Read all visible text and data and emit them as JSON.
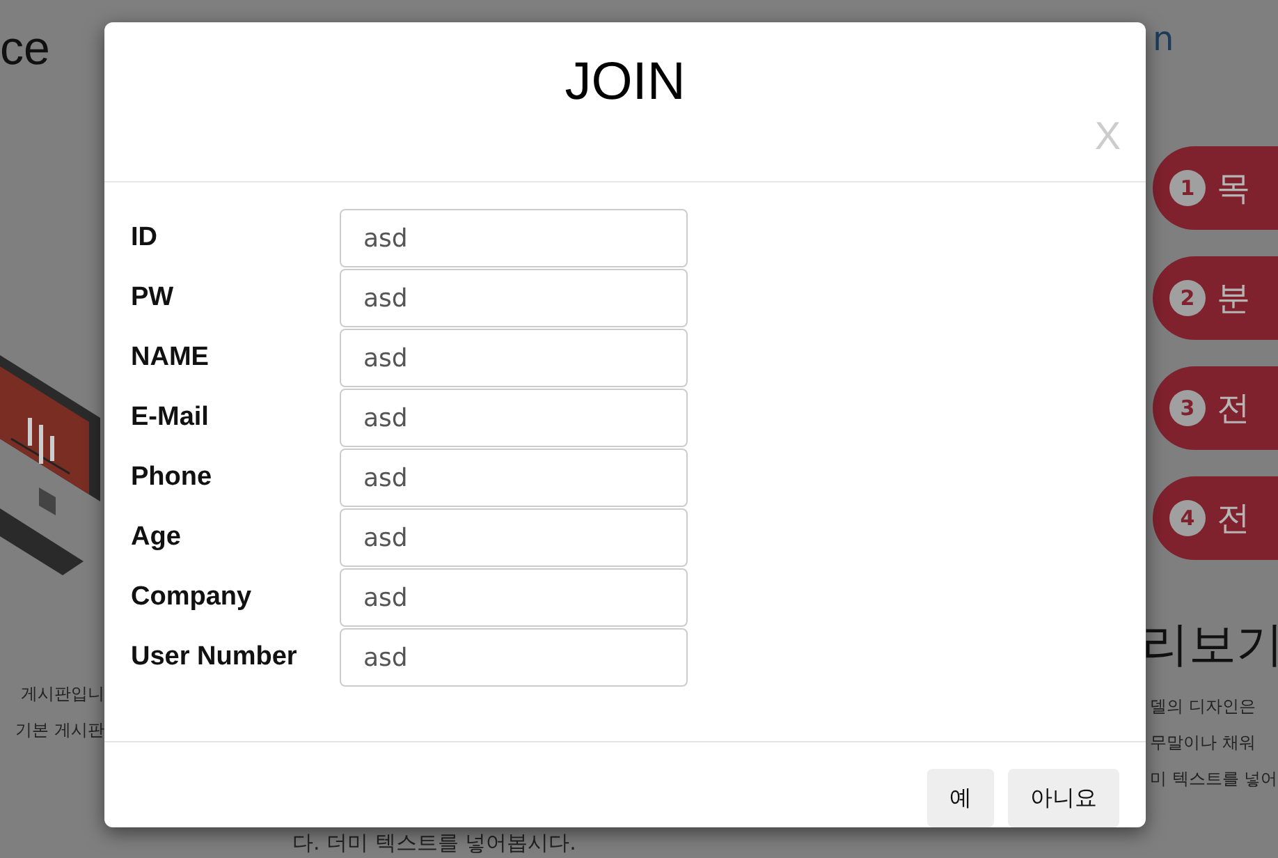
{
  "background": {
    "left_heading": "ce",
    "left_paragraph": [
      "게시판입니",
      "기본 게시판"
    ],
    "right_link": "n",
    "steps": [
      {
        "number": "1",
        "label": "목"
      },
      {
        "number": "2",
        "label": "분"
      },
      {
        "number": "3",
        "label": "전"
      },
      {
        "number": "4",
        "label": "전"
      }
    ],
    "right_heading": "리보기",
    "right_paragraph": [
      "델의 디자인은",
      "무말이나 채워",
      "미 텍스트를 넣어"
    ],
    "bottom_text": "다. 더미 텍스트를 넣어봅시다."
  },
  "dialog": {
    "title": "JOIN",
    "close": "X",
    "fields": [
      {
        "label": "ID",
        "value": "asd"
      },
      {
        "label": "PW",
        "value": "asd"
      },
      {
        "label": "NAME",
        "value": "asd"
      },
      {
        "label": "E-Mail",
        "value": "asd"
      },
      {
        "label": "Phone",
        "value": "asd"
      },
      {
        "label": "Age",
        "value": "asd"
      },
      {
        "label": "Company",
        "value": "asd"
      },
      {
        "label": "User Number",
        "value": "asd"
      }
    ],
    "buttons": [
      "예",
      "아니요"
    ]
  }
}
